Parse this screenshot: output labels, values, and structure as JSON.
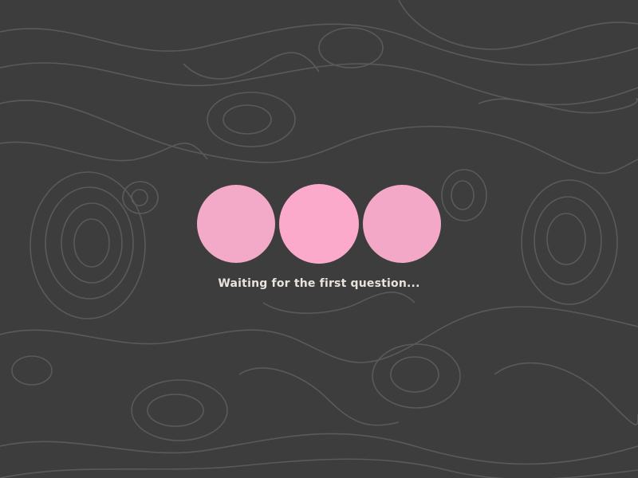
{
  "status": {
    "text": "Waiting for the first question..."
  },
  "loader": {
    "dots": [
      {
        "color": "#f3a9c8"
      },
      {
        "color": "#fbaacb"
      },
      {
        "color": "#f4a8c7"
      }
    ]
  },
  "theme": {
    "background": "#3d3d3d",
    "contour_lines": "#5a5a5a",
    "text": "#e8e3dc"
  }
}
